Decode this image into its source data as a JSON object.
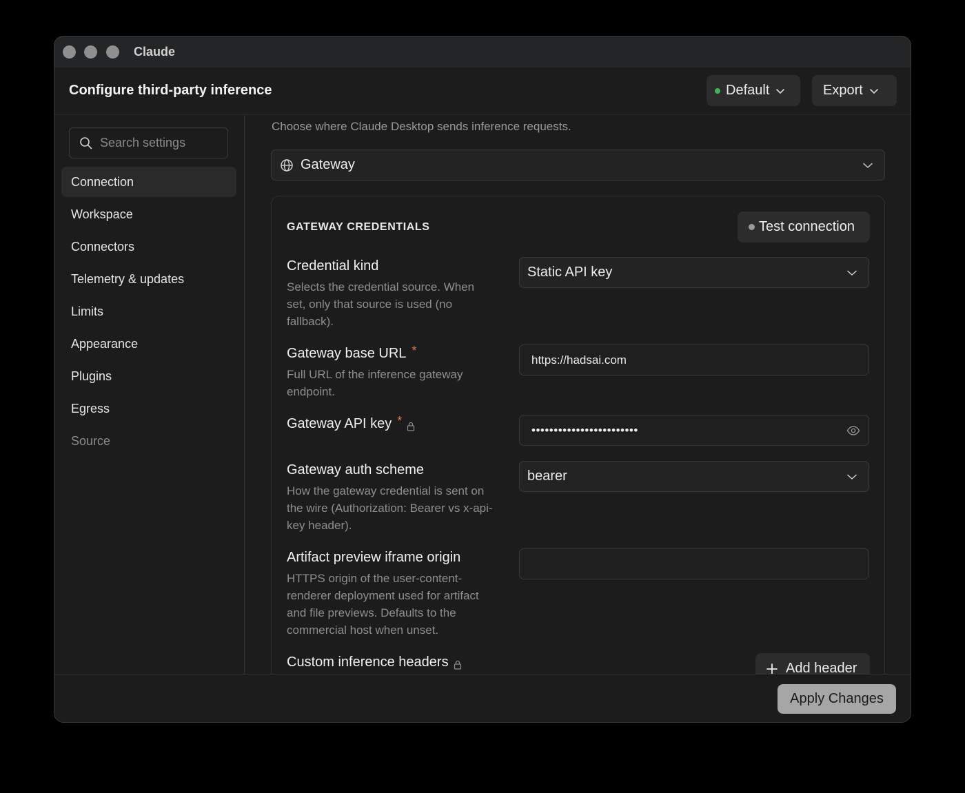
{
  "window": {
    "app_title": "Claude"
  },
  "header": {
    "title": "Configure third-party inference",
    "profile_label": "Default",
    "export_label": "Export"
  },
  "sidebar": {
    "search_placeholder": "Search settings",
    "items": [
      {
        "label": "Connection",
        "active": true
      },
      {
        "label": "Workspace"
      },
      {
        "label": "Connectors"
      },
      {
        "label": "Telemetry & updates"
      },
      {
        "label": "Limits"
      },
      {
        "label": "Appearance"
      },
      {
        "label": "Plugins"
      },
      {
        "label": "Egress"
      },
      {
        "label": "Source",
        "muted": true
      }
    ]
  },
  "main": {
    "intro": "Choose where Claude Desktop sends inference requests.",
    "provider_value": "Gateway",
    "section_title": "GATEWAY CREDENTIALS",
    "test_connection_label": "Test connection",
    "fields": {
      "credential_kind": {
        "label": "Credential kind",
        "description": "Selects the credential source. When set, only that source is used (no fallback).",
        "value": "Static API key"
      },
      "base_url": {
        "label": "Gateway base URL",
        "required_mark": "*",
        "description": "Full URL of the inference gateway endpoint.",
        "value": "https://hadsai.com"
      },
      "api_key": {
        "label": "Gateway API key",
        "required_mark": "*",
        "value": "••••••••••••••••••••••••"
      },
      "auth_scheme": {
        "label": "Gateway auth scheme",
        "description": "How the gateway credential is sent on the wire (Authorization: Bearer vs x-api-key header).",
        "value": "bearer"
      },
      "artifact_origin": {
        "label": "Artifact preview iframe origin",
        "description": "HTTPS origin of the user-content-renderer deployment used for artifact and file previews. Defaults to the commercial host when unset.",
        "value": ""
      },
      "custom_headers": {
        "label": "Custom inference headers",
        "add_label": "Add header"
      }
    }
  },
  "footer": {
    "apply_label": "Apply Changes"
  },
  "colors": {
    "status_green": "#3fb950",
    "required_orange": "#d9774b",
    "apply_bg": "#a6a6a6"
  },
  "icons": {
    "search": "search-icon",
    "provider": "globe-icon",
    "lock": "lock-icon",
    "eye": "eye-icon",
    "add": "plus-icon",
    "chevron": "chevron-down-icon"
  }
}
